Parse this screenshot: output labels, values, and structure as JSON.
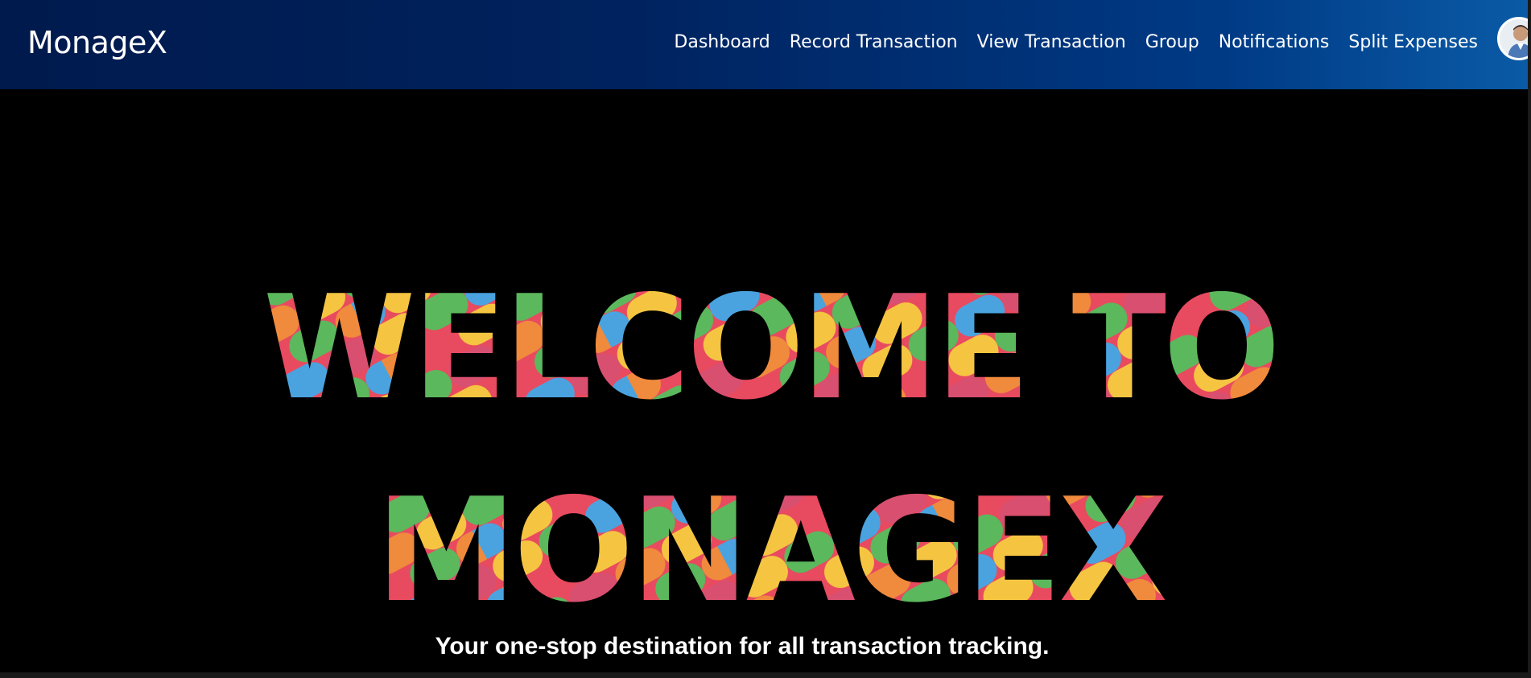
{
  "navbar": {
    "brand": "MonageX",
    "links": [
      {
        "label": "Dashboard"
      },
      {
        "label": "Record Transaction"
      },
      {
        "label": "View Transaction"
      },
      {
        "label": "Group"
      },
      {
        "label": "Notifications"
      },
      {
        "label": "Split Expenses"
      }
    ],
    "avatar_icon": "user-avatar-icon"
  },
  "hero": {
    "line1": "WELCOME TO",
    "line2": "MONAGEX",
    "tagline": "Your one-stop destination for all transaction tracking."
  },
  "colors": {
    "navbar_start": "#001a4d",
    "navbar_end": "#0a5aa6",
    "candy": [
      "#e84a5f",
      "#f5c542",
      "#5cb85c",
      "#4aa3df",
      "#f08a3c",
      "#d94f70"
    ]
  }
}
